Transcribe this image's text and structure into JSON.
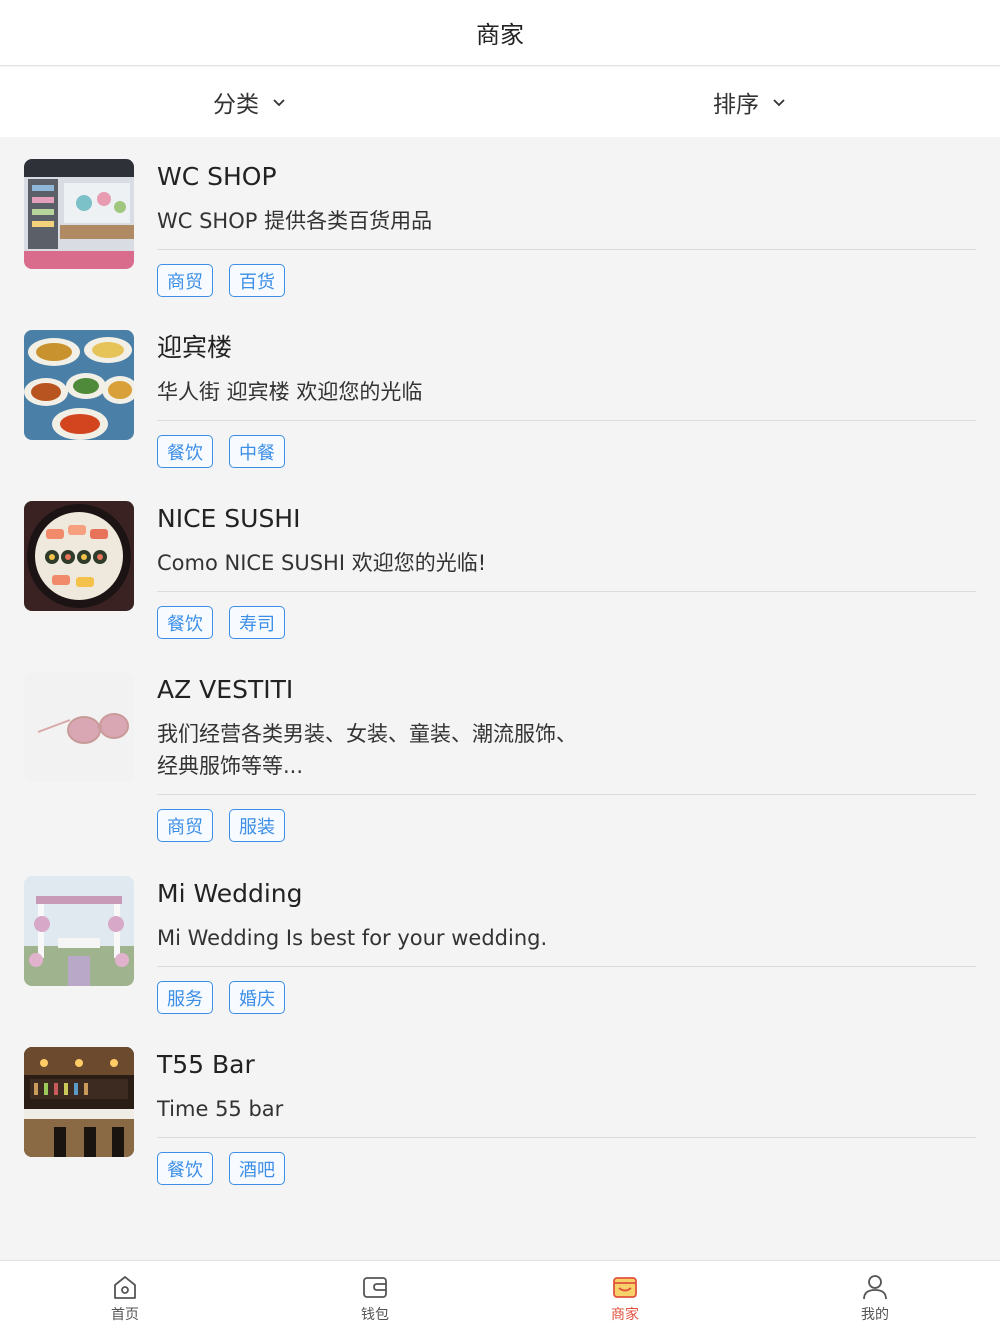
{
  "header": {
    "title": "商家"
  },
  "filters": {
    "category_label": "分类",
    "sort_label": "排序"
  },
  "merchants": [
    {
      "name": "WC SHOP",
      "desc": "WC SHOP 提供各类百货用品",
      "tags": [
        "商贸",
        "百货"
      ],
      "thumb_icon": "shop-shelves-photo"
    },
    {
      "name": "迎宾楼",
      "desc": "华人街 迎宾楼 欢迎您的光临",
      "tags": [
        "餐饮",
        "中餐"
      ],
      "thumb_icon": "chinese-dishes-photo"
    },
    {
      "name": "NICE SUSHI",
      "desc": "Como NICE SUSHI 欢迎您的光临!",
      "tags": [
        "餐饮",
        "寿司"
      ],
      "thumb_icon": "sushi-platter-photo"
    },
    {
      "name": "AZ VESTITI",
      "desc": "我们经营各类男装、女装、童装、潮流服饰、经典服饰等等...",
      "tags": [
        "商贸",
        "服装"
      ],
      "thumb_icon": "sunglasses-photo"
    },
    {
      "name": "Mi Wedding",
      "desc": "Mi Wedding Is best for your wedding.",
      "tags": [
        "服务",
        "婚庆"
      ],
      "thumb_icon": "wedding-arch-photo"
    },
    {
      "name": "T55 Bar",
      "desc": "Time 55 bar",
      "tags": [
        "餐饮",
        "酒吧"
      ],
      "thumb_icon": "bar-interior-photo"
    }
  ],
  "tabbar": {
    "items": [
      {
        "label": "首页",
        "icon": "home-icon",
        "active": false
      },
      {
        "label": "钱包",
        "icon": "wallet-icon",
        "active": false
      },
      {
        "label": "商家",
        "icon": "store-icon",
        "active": true
      },
      {
        "label": "我的",
        "icon": "user-icon",
        "active": false
      }
    ]
  },
  "colors": {
    "accent": "#3c8ee6",
    "active_tab": "#e0533d",
    "background": "#f4f4f4"
  }
}
